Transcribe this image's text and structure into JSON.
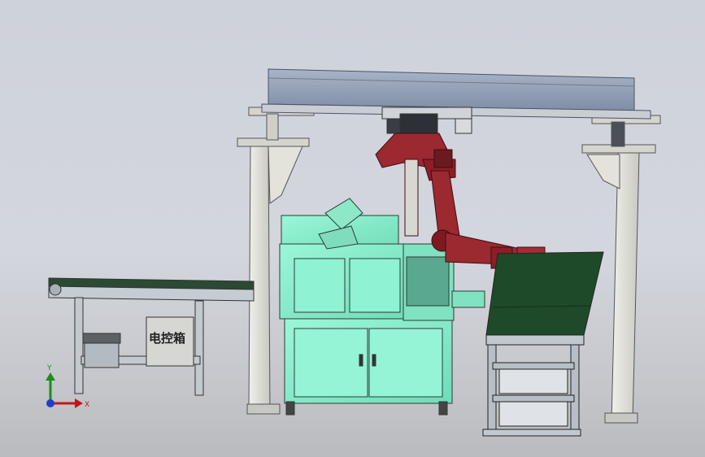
{
  "cabinet_label": "电控箱",
  "triad": {
    "y_label": "Y",
    "x_label": "X"
  },
  "colors": {
    "background": "#d0d3da",
    "gantry_beam": "#8d9bb2",
    "frame": "#dcdcd6",
    "machine": "#86f0cc",
    "robot": "#9c2830",
    "conveyor_belt": "#1f4a2a",
    "steel": "#b9bfc7"
  }
}
